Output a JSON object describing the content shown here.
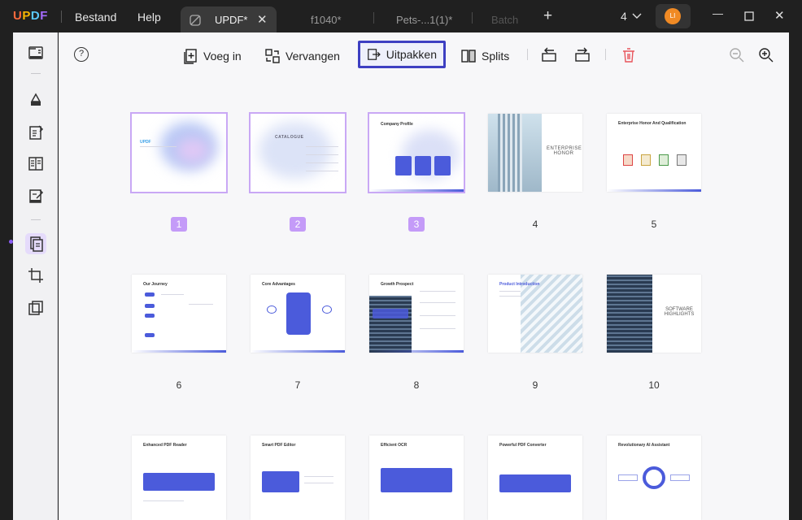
{
  "app": {
    "logo": "UPDF",
    "menu_file": "Bestand",
    "menu_help": "Help"
  },
  "tabs": [
    {
      "label": "UPDF*",
      "close": "✕"
    },
    {
      "label": "f1040*"
    },
    {
      "label": "Pets-...1(1)*"
    },
    {
      "label": "Batch"
    }
  ],
  "add_tab": "+",
  "window": {
    "tab_count": "4",
    "chevron": "⌄",
    "avatar_initials": "LI",
    "minimize": "—",
    "maximize": "☐",
    "close": "✕"
  },
  "toolbar": {
    "help": "?",
    "insert_label": "Voeg in",
    "replace_label": "Vervangen",
    "extract_label": "Uitpakken",
    "split_label": "Splits"
  },
  "pages": [
    {
      "num": "1",
      "selected": true,
      "title": "UPDF"
    },
    {
      "num": "2",
      "selected": true,
      "title": "CATALOGUE"
    },
    {
      "num": "3",
      "selected": true,
      "title": "Company Profile"
    },
    {
      "num": "4",
      "selected": false,
      "title": "ENTERPRISE HONOR"
    },
    {
      "num": "5",
      "selected": false,
      "title": "Enterprise Honor And Qualification"
    },
    {
      "num": "6",
      "selected": false,
      "title": "Our Journey"
    },
    {
      "num": "7",
      "selected": false,
      "title": "Core Advantages"
    },
    {
      "num": "8",
      "selected": false,
      "title": "Growth Prospect"
    },
    {
      "num": "9",
      "selected": false,
      "title": "Product Introduction"
    },
    {
      "num": "10",
      "selected": false,
      "title": "SOFTWARE HIGHLIGHTS"
    },
    {
      "num": "",
      "selected": false,
      "title": "Enhanced PDF Reader"
    },
    {
      "num": "",
      "selected": false,
      "title": "Smart PDF Editor"
    },
    {
      "num": "",
      "selected": false,
      "title": "Efficient OCR"
    },
    {
      "num": "",
      "selected": false,
      "title": "Powerful PDF Converter"
    },
    {
      "num": "",
      "selected": false,
      "title": "Revolutionary AI Assistant"
    }
  ],
  "colors": {
    "accent": "#8a5cf5",
    "selection": "#c49bf8",
    "highlight_border": "#3d3fc2",
    "brand_blue": "#4b5bdb"
  }
}
